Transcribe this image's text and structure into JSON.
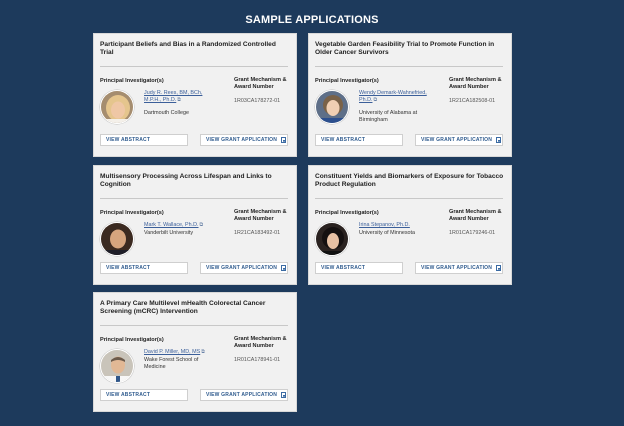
{
  "section_title": "SAMPLE APPLICATIONS",
  "labels": {
    "pi": "Principal Investigator(s)",
    "grant_mechanism": "Grant Mechanism & Award Number",
    "view_abstract": "VIEW ABSTRACT",
    "view_grant": "VIEW GRANT APPLICATION"
  },
  "cards": [
    {
      "title": "Participant Beliefs and Bias in a Randomized Controlled Trial",
      "pi_name": "Judy R. Rees, BM, BCh, M.P.H., Ph.D.",
      "institution": "Dartmouth College",
      "award": "1R03CA178272-01",
      "avatar": "woman-blonde-photo"
    },
    {
      "title": "Vegetable Garden Feasibility Trial to Promote Function in Older Cancer Survivors",
      "pi_name": "Wendy Demark-Wahnefried, Ph.D.",
      "institution": "University of Alabama at Birmingham",
      "award": "1R21CA182508-01",
      "avatar": "woman-short-hair-photo"
    },
    {
      "title": "Multisensory Processing Across Lifespan and Links to Cognition",
      "pi_name": "Mark T. Wallace, Ph.D.",
      "institution": "Vanderbilt University",
      "award": "1R21CA183492-01",
      "avatar": "man-bald-photo"
    },
    {
      "title": "Constituent Yields and Biomarkers of Exposure for Tobacco Product Regulation",
      "pi_name": "Irina Stepanov, Ph.D.",
      "institution": "University of Minnesota",
      "award": "1R01CA179246-01",
      "avatar": "woman-dark-hair-photo"
    },
    {
      "title": "A Primary Care Multilevel mHealth Colorectal Cancer Screening (mCRC) Intervention",
      "pi_name": "David P. Miller, MD, MS",
      "institution": "Wake Forest School of Medicine",
      "award": "1R01CA178941-01",
      "avatar": "man-white-coat-photo"
    }
  ]
}
